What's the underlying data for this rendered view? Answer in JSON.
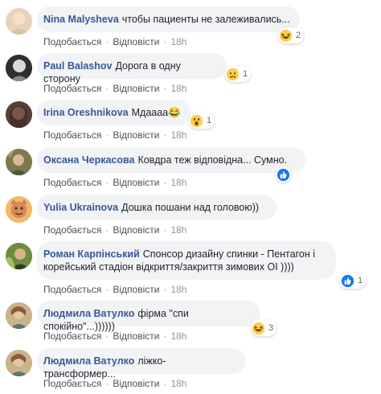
{
  "comments": [
    {
      "author": "Nina Malysheva",
      "text": "чтобы пациенты не залеживались...",
      "like": "Подобається",
      "reply": "Відповісти",
      "time": "18h",
      "reaction_icon": "laughing-emoji",
      "reaction_count": "2"
    },
    {
      "author": "Paul Balashov",
      "text": "Дорога в одну сторону",
      "like": "Подобається",
      "reply": "Відповісти",
      "time": "18h",
      "reaction_icon": "sad-emoji",
      "reaction_count": "1"
    },
    {
      "author": "Irina Oreshnikova",
      "text": "Мдаааа😂",
      "like": "Подобається",
      "reply": "Відповісти",
      "time": "18h",
      "reaction_icon": "wow-emoji",
      "reaction_count": "1"
    },
    {
      "author": "Оксана Черкасова",
      "text": "Ковдра теж відповідна... Сумно.",
      "like": "Подобається",
      "reply": "Відповісти",
      "time": "18h",
      "reaction_icon": "like-icon",
      "reaction_count": ""
    },
    {
      "author": "Yulia Ukrainova",
      "text": "Дошка пошани над головою))",
      "like": "Подобається",
      "reply": "Відповісти",
      "time": "18h",
      "reaction_icon": "",
      "reaction_count": ""
    },
    {
      "author": "Роман Карпінський",
      "text": "Спонсор дизайну спинки - Пентагон і корейський стадіон відкриття/закриття зимових ОІ ))))",
      "like": "Подобається",
      "reply": "Відповісти",
      "time": "18h",
      "reaction_icon": "like-icon",
      "reaction_count": "1"
    },
    {
      "author": "Людмила Ватулко",
      "text": "фірма \"спи спокійно\"...))))))",
      "like": "Подобається",
      "reply": "Відповісти",
      "time": "18h",
      "reaction_icon": "laughing-emoji",
      "reaction_count": "3"
    },
    {
      "author": "Людмила Ватулко",
      "text": "ліжко-трансформер...",
      "like": "Подобається",
      "reply": "Відповісти",
      "time": "18h",
      "reaction_icon": "",
      "reaction_count": ""
    }
  ],
  "colors": {
    "link": "#385898",
    "bubble": "#f2f3f5",
    "like_blue": "#1877f2",
    "emoji_yellow": "#ffcc4d"
  }
}
